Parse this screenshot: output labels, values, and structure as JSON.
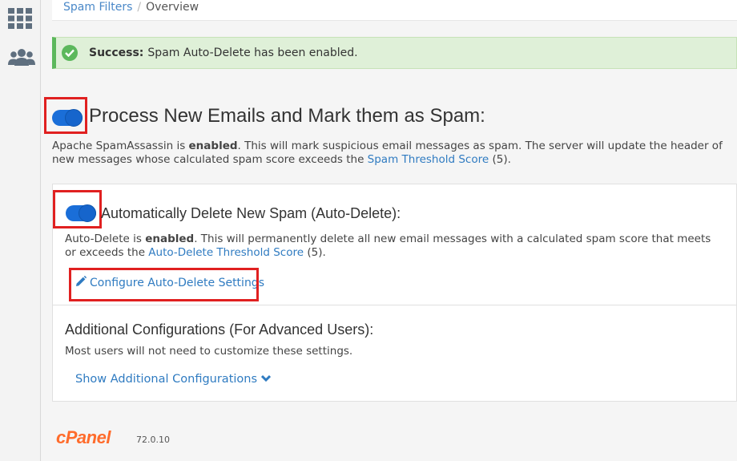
{
  "breadcrumb": {
    "parent": "Spam Filters",
    "separator": "/",
    "current": "Overview"
  },
  "alert": {
    "strong": "Success:",
    "message": "Spam Auto-Delete has been enabled."
  },
  "process": {
    "title": "Process New Emails and Mark them as Spam:",
    "enabled": true,
    "desc_prefix": "Apache SpamAssassin is ",
    "desc_bold": "enabled",
    "desc_middle": ". This will mark suspicious email messages as spam. The server will update the header of new messages whose calculated spam score exceeds the ",
    "link": "Spam Threshold Score",
    "desc_suffix": " (5)."
  },
  "auto_delete": {
    "title": "Automatically Delete New Spam (Auto-Delete):",
    "enabled": true,
    "desc_prefix": "Auto-Delete is ",
    "desc_bold": "enabled",
    "desc_middle": ". This will permanently delete all new email messages with a calculated spam score that meets or exceeds the ",
    "link": "Auto-Delete Threshold Score",
    "desc_suffix": " (5).",
    "configure_label": "Configure Auto-Delete Settings"
  },
  "additional": {
    "title": "Additional Configurations (For Advanced Users):",
    "desc": "Most users will not need to customize these settings.",
    "show_label": "Show Additional Configurations"
  },
  "footer": {
    "logo": "cPanel",
    "version": "72.0.10"
  },
  "colors": {
    "accent": "#1a6ed8",
    "link": "#2f7bc1",
    "success": "#5cb85c",
    "highlight": "#e02020",
    "brand": "#ff6c2c"
  },
  "icons": {
    "sidebar_top": "grid-icon",
    "sidebar_second": "users-icon",
    "alert": "check-icon",
    "configure": "pencil-icon",
    "show": "chevron-down-icon"
  }
}
